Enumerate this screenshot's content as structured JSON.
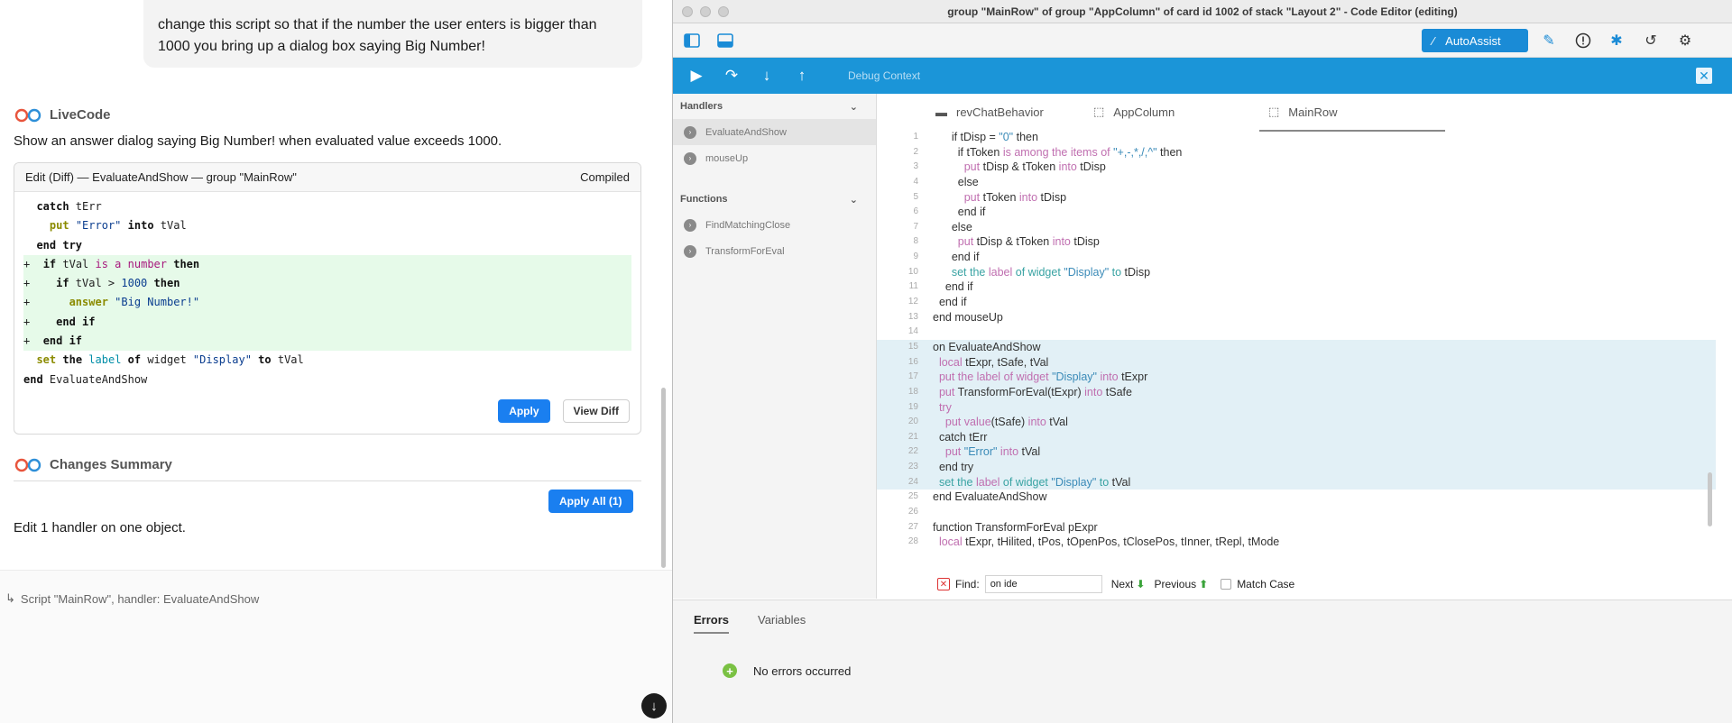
{
  "chat": {
    "user_message": "change this script so that if the number the user enters is bigger than 1000 you bring up a dialog box saying Big Number!",
    "assistant_name": "LiveCode",
    "assistant_reply": "Show an answer dialog saying Big Number! when evaluated value exceeds 1000.",
    "diff": {
      "title": "Edit (Diff) — EvaluateAndShow — group \"MainRow\"",
      "status": "Compiled",
      "apply_label": "Apply",
      "view_diff_label": "View Diff"
    },
    "summary": {
      "title": "Changes Summary",
      "apply_all_label": "Apply All (1)",
      "text": "Edit 1 handler on one object."
    },
    "context_line": "Script \"MainRow\", handler: EvaluateAndShow"
  },
  "editor": {
    "title": "group \"MainRow\" of group \"AppColumn\" of card id 1002 of stack \"Layout 2\" - Code Editor (editing)",
    "autoassist_label": "AutoAssist",
    "debug_context_label": "Debug Context",
    "sidebar": {
      "handlers_label": "Handlers",
      "handlers": [
        "EvaluateAndShow",
        "mouseUp"
      ],
      "functions_label": "Functions",
      "functions": [
        "FindMatchingClose",
        "TransformForEval"
      ]
    },
    "tabs": [
      "revChatBehavior",
      "AppColumn",
      "MainRow"
    ],
    "find": {
      "label": "Find:",
      "value": "on ide",
      "next_label": "Next",
      "previous_label": "Previous",
      "match_case_label": "Match Case"
    },
    "bottom_tabs": [
      "Errors",
      "Variables"
    ],
    "errors_message": "No errors occurred"
  },
  "colors": {
    "accent": "#1a8bd6",
    "debug_bar": "#1b95d8",
    "diff_added": "#e6fae9",
    "apply_button": "#1a7ff0",
    "selected_code": "#e2f0f6"
  }
}
